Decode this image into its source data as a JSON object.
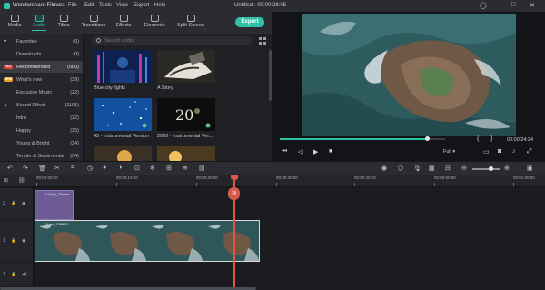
{
  "app": {
    "name": "Wondershare Filmora",
    "document_title": "Untitled : 00:00:28:05"
  },
  "menu": [
    "File",
    "Edit",
    "Tools",
    "View",
    "Export",
    "Help"
  ],
  "toolbar": {
    "tabs": [
      "Media",
      "Audio",
      "Titles",
      "Transitions",
      "Effects",
      "Elements",
      "Split Screen"
    ],
    "active_tab": "Audio",
    "export_label": "Export",
    "accent": "#2ec3a8"
  },
  "sidebar": {
    "items": [
      {
        "label": "Favorites",
        "count": "(0)",
        "icon": "heart-icon"
      },
      {
        "label": "Downloads",
        "count": "(0)"
      },
      {
        "label": "Recommended",
        "count": "(500)",
        "badge": "HOT",
        "selected": true
      },
      {
        "label": "What's new",
        "count": "(39)",
        "badge": "NEW"
      },
      {
        "label": "Exclusive Music",
        "count": "(22)"
      },
      {
        "label": "Sound Effect",
        "count": "(1105)",
        "icon": "caret-right-icon"
      },
      {
        "label": "Intro",
        "count": "(22)"
      },
      {
        "label": "Happy",
        "count": "(35)"
      },
      {
        "label": "Young & Bright",
        "count": "(34)"
      },
      {
        "label": "Tender & Sentimental",
        "count": "(34)"
      }
    ]
  },
  "library": {
    "search_placeholder": "Search audio",
    "items": [
      {
        "title": "Blue city lights"
      },
      {
        "title": "A Story"
      },
      {
        "title": "45 - Instrumental Version"
      },
      {
        "title": "2020 - Instrumental Ver..."
      }
    ]
  },
  "preview": {
    "timecode": "00:00:24:24",
    "bracket_in": "{",
    "bracket_out": "}",
    "quality": "Full",
    "progress": 0.89
  },
  "timeline": {
    "ruler_labels": [
      "00:00:00:00",
      "00:00:10:00",
      "00:00:20:00",
      "00:00:30:00",
      "00:00:40:00",
      "00:00:50:00",
      "00:01:00:00"
    ],
    "tracks": {
      "audio_clip_name": "Activity_Theme",
      "video_clip_name": "Video_138960",
      "track_labels": [
        "2",
        "1",
        "1"
      ]
    }
  }
}
